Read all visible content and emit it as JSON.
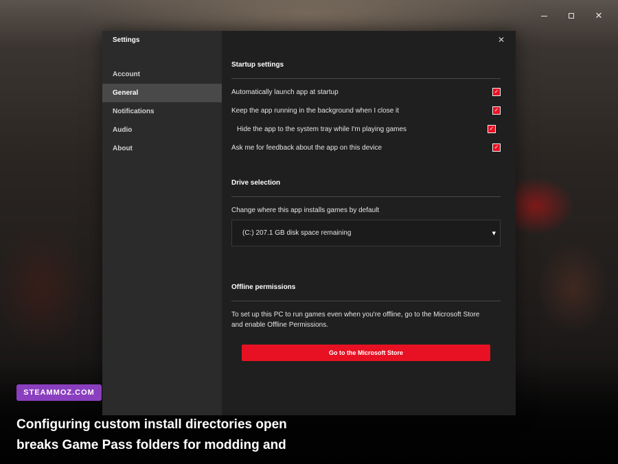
{
  "window_controls": {
    "minimize_icon": "minimize-icon",
    "maximize_icon": "maximize-icon",
    "close_glyph": "✕"
  },
  "sidebar": {
    "title": "Settings",
    "items": [
      {
        "label": "Account",
        "active": false
      },
      {
        "label": "General",
        "active": true
      },
      {
        "label": "Notifications",
        "active": false
      },
      {
        "label": "Audio",
        "active": false
      },
      {
        "label": "About",
        "active": false
      }
    ]
  },
  "dialog": {
    "close_glyph": "✕"
  },
  "startup": {
    "title": "Startup settings",
    "options": [
      {
        "label": "Automatically launch app at startup",
        "checked": true
      },
      {
        "label": "Keep the app running in the background when I close it",
        "checked": true
      },
      {
        "label": "Hide the app to the system tray while I'm playing games",
        "checked": true
      },
      {
        "label": "Ask me for feedback about the app on this device",
        "checked": true
      }
    ]
  },
  "drive": {
    "title": "Drive selection",
    "description": "Change where this app installs games by default",
    "selected": "(C:) 207.1 GB disk space remaining",
    "caret": "▼"
  },
  "offline": {
    "title": "Offline permissions",
    "line1": "To set up this PC to run games even when you're offline, go to the Microsoft Store",
    "line2": "and enable Offline Permissions.",
    "button": "Go to the Microsoft Store"
  },
  "checkmark": "✓",
  "watermark": "STEAMMOZ.COM",
  "caption": {
    "line1": "Configuring custom install directories open",
    "line2": "breaks Game Pass folders for modding and"
  },
  "colors": {
    "accent": "#e81123",
    "badge": "#8a3fbf",
    "sidebar": "#2b2b2b",
    "sidebar_active": "#494949",
    "content": "#1f1f1f"
  }
}
